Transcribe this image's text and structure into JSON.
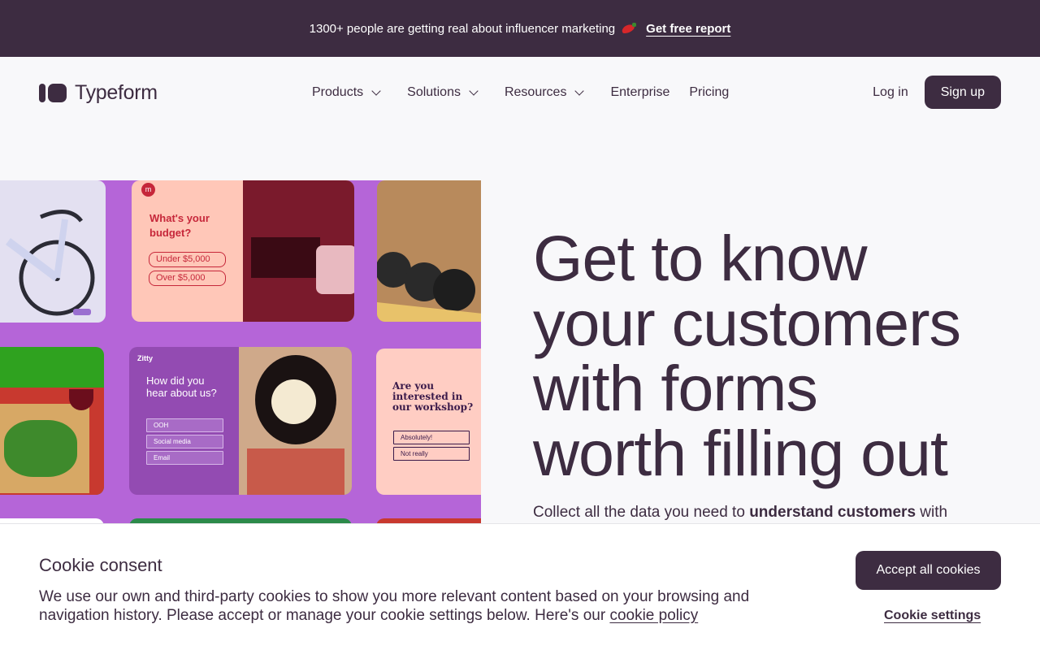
{
  "announcement": {
    "text": "1300+ people are getting real about influencer marketing",
    "link": "Get free report",
    "icon": "chili-icon"
  },
  "nav": {
    "logo": "Typeform",
    "items": [
      {
        "label": "Products",
        "dropdown": true
      },
      {
        "label": "Solutions",
        "dropdown": true
      },
      {
        "label": "Resources",
        "dropdown": true
      },
      {
        "label": "Enterprise",
        "dropdown": false
      },
      {
        "label": "Pricing",
        "dropdown": false
      }
    ],
    "login": "Log in",
    "signup": "Sign up"
  },
  "hero": {
    "title_lines": [
      "Get to know",
      "your customers",
      "with forms",
      "worth filling out"
    ],
    "sub_pre": "Collect all the data you need to ",
    "sub_bold": "understand customers",
    "sub_post": " with",
    "collage": {
      "budget_q": "What's your budget?",
      "budget_opts": [
        "Under $5,000",
        "Over $5,000"
      ],
      "zitty_brand": "Zitty",
      "zitty_q": "How did you hear about us?",
      "zitty_opts": [
        "OOH",
        "Social media",
        "Email"
      ],
      "workshop_q": "Are you interested in our workshop?",
      "workshop_opts": [
        "Absolutely!",
        "Not really"
      ]
    }
  },
  "cookie": {
    "title": "Cookie consent",
    "text": "We use our own and third-party cookies to show you more relevant content based on your browsing and navigation history. Please accept or manage your cookie settings below. Here's our ",
    "link": "cookie policy",
    "accept": "Accept all cookies",
    "settings": "Cookie settings"
  },
  "colors": {
    "brand": "#3d2c41",
    "collage_bg": "#b565d8"
  }
}
